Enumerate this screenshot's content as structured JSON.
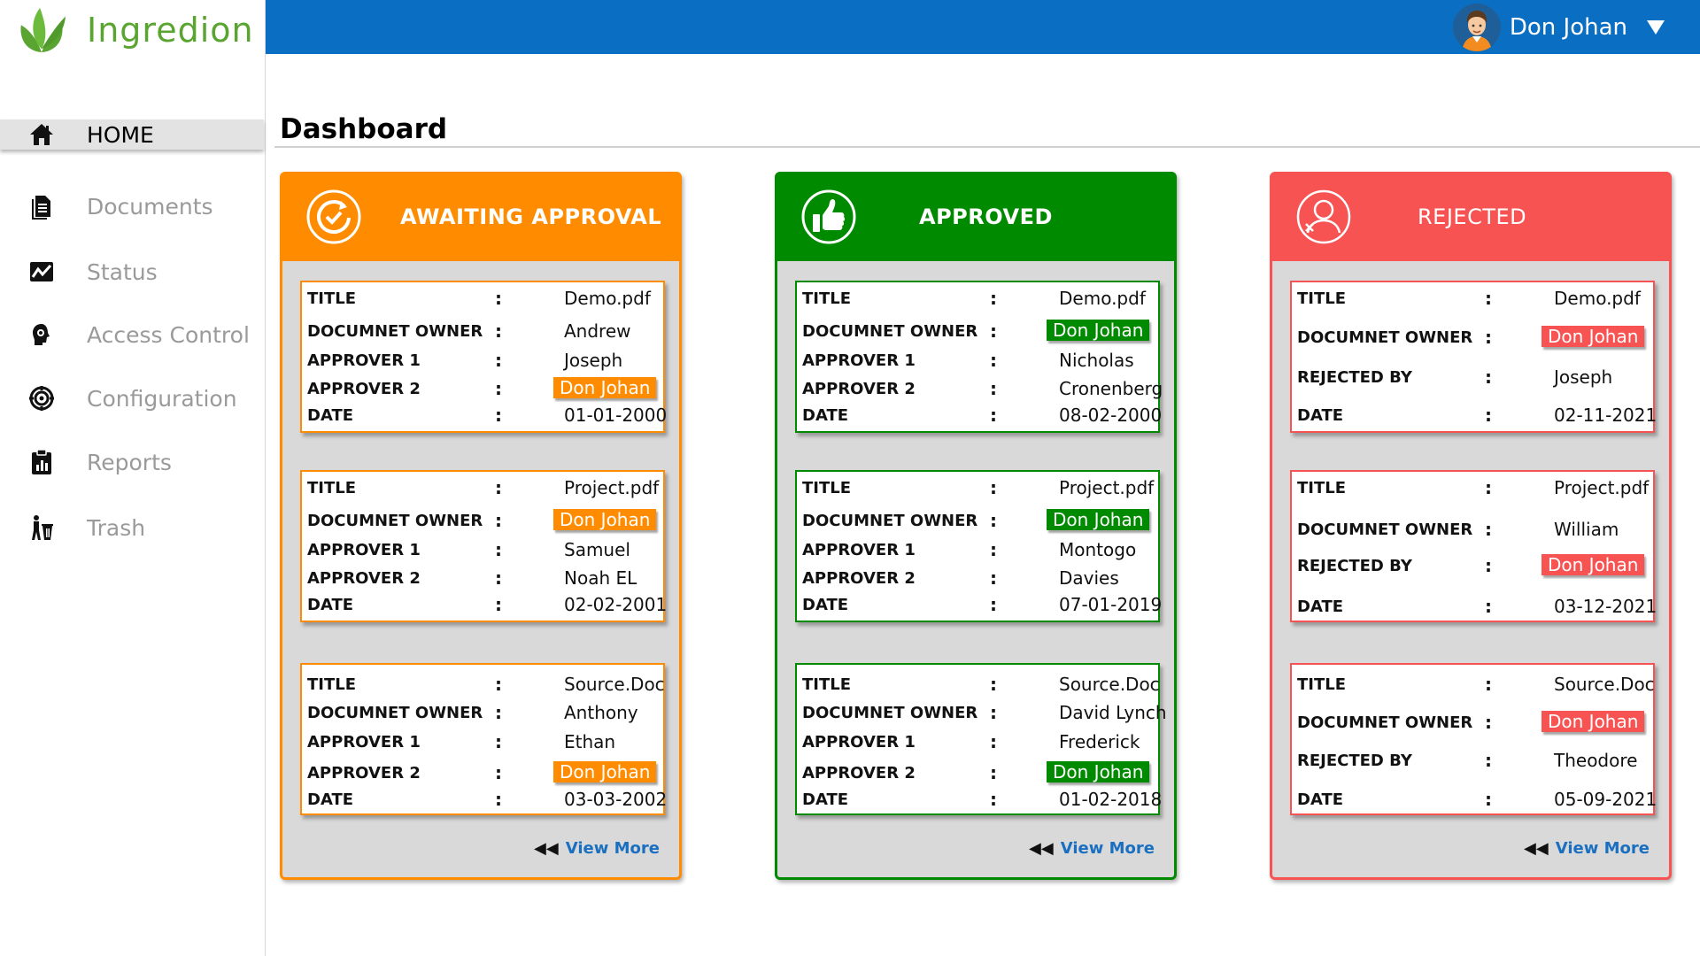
{
  "brand": {
    "name": "Ingredion",
    "color": "#5aa532"
  },
  "header": {
    "user_name": "Don Johan",
    "bar_color": "#0a6fc2"
  },
  "sidebar": {
    "items": [
      {
        "label": "HOME",
        "icon": "home-icon"
      },
      {
        "label": "Documents",
        "icon": "document-icon"
      },
      {
        "label": "Status",
        "icon": "status-chart-icon"
      },
      {
        "label": "Access Control",
        "icon": "access-control-icon"
      },
      {
        "label": "Configuration",
        "icon": "gear-icon"
      },
      {
        "label": "Reports",
        "icon": "clipboard-report-icon"
      },
      {
        "label": "Trash",
        "icon": "trash-icon"
      }
    ]
  },
  "page": {
    "title": "Dashboard"
  },
  "panels": [
    {
      "title": "AWAITING APPROVAL",
      "color": "#ff8c00",
      "icon": "refresh-check-icon",
      "view_more": "View More",
      "cards": [
        {
          "rows": [
            {
              "label": "TITLE",
              "value": "Demo.pdf"
            },
            {
              "label": "DOCUMNET OWNER",
              "value": "Andrew"
            },
            {
              "label": "APPROVER 1",
              "value": "Joseph"
            },
            {
              "label": "APPROVER 2",
              "value": "Don Johan",
              "highlight": true
            },
            {
              "label": "DATE",
              "value": "01-01-2000"
            }
          ]
        },
        {
          "rows": [
            {
              "label": "TITLE",
              "value": "Project.pdf"
            },
            {
              "label": "DOCUMNET OWNER",
              "value": "Don Johan",
              "highlight": true
            },
            {
              "label": "APPROVER 1",
              "value": "Samuel"
            },
            {
              "label": "APPROVER 2",
              "value": "Noah EL"
            },
            {
              "label": "DATE",
              "value": "02-02-2001"
            }
          ]
        },
        {
          "rows": [
            {
              "label": "TITLE",
              "value": "Source.Doc"
            },
            {
              "label": "DOCUMNET OWNER",
              "value": "Anthony"
            },
            {
              "label": "APPROVER 1",
              "value": "Ethan"
            },
            {
              "label": "APPROVER 2",
              "value": "Don Johan",
              "highlight": true
            },
            {
              "label": "DATE",
              "value": "03-03-2002"
            }
          ]
        }
      ]
    },
    {
      "title": "APPROVED",
      "color": "#008a00",
      "icon": "thumbs-up-icon",
      "view_more": "View More",
      "cards": [
        {
          "rows": [
            {
              "label": "TITLE",
              "value": "Demo.pdf"
            },
            {
              "label": "DOCUMNET OWNER",
              "value": "Don Johan",
              "highlight": true
            },
            {
              "label": "APPROVER 1",
              "value": "Nicholas"
            },
            {
              "label": "APPROVER 2",
              "value": "Cronenberg"
            },
            {
              "label": "DATE",
              "value": "08-02-2000"
            }
          ]
        },
        {
          "rows": [
            {
              "label": "TITLE",
              "value": "Project.pdf"
            },
            {
              "label": "DOCUMNET OWNER",
              "value": "Don Johan",
              "highlight": true
            },
            {
              "label": "APPROVER 1",
              "value": "Montogo"
            },
            {
              "label": "APPROVER 2",
              "value": "Davies"
            },
            {
              "label": "DATE",
              "value": "07-01-2019"
            }
          ]
        },
        {
          "rows": [
            {
              "label": "TITLE",
              "value": "Source.Doc"
            },
            {
              "label": "DOCUMNET OWNER",
              "value": "David Lynch"
            },
            {
              "label": "APPROVER 1",
              "value": "Frederick"
            },
            {
              "label": "APPROVER 2",
              "value": "Don Johan",
              "highlight": true
            },
            {
              "label": "DATE",
              "value": "01-02-2018"
            }
          ]
        }
      ]
    },
    {
      "title": "REJECTED",
      "color": "#f75353",
      "icon": "rejected-user-icon",
      "view_more": "View More",
      "cards": [
        {
          "rows": [
            {
              "label": "TITLE",
              "value": "Demo.pdf"
            },
            {
              "label": "DOCUMNET OWNER",
              "value": "Don Johan",
              "highlight": true
            },
            {
              "label": "REJECTED BY",
              "value": "Joseph"
            },
            {
              "label": "DATE",
              "value": "02-11-2021"
            }
          ]
        },
        {
          "rows": [
            {
              "label": "TITLE",
              "value": "Project.pdf"
            },
            {
              "label": "DOCUMNET OWNER",
              "value": "William"
            },
            {
              "label": "REJECTED BY",
              "value": "Don Johan",
              "highlight": true
            },
            {
              "label": "DATE",
              "value": "03-12-2021"
            }
          ]
        },
        {
          "rows": [
            {
              "label": "TITLE",
              "value": "Source.Doc"
            },
            {
              "label": "DOCUMNET OWNER",
              "value": "Don Johan",
              "highlight": true
            },
            {
              "label": "REJECTED BY",
              "value": "Theodore"
            },
            {
              "label": "DATE",
              "value": "05-09-2021"
            }
          ]
        }
      ]
    }
  ]
}
